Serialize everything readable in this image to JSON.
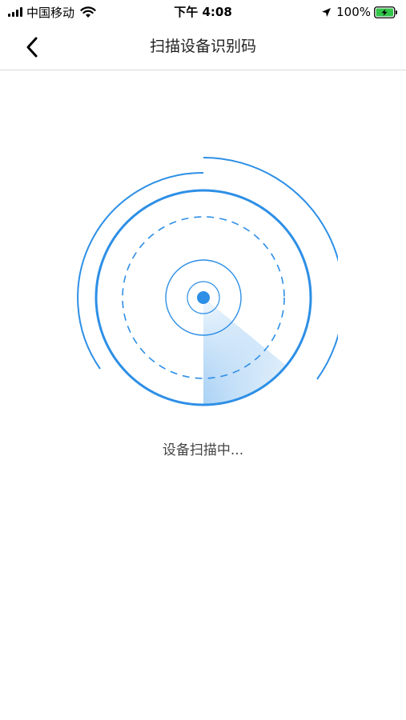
{
  "status_bar": {
    "carrier": "中国移动",
    "time": "下午 4:08",
    "battery_percent": "100%",
    "icons": [
      "signal-icon",
      "wifi-icon",
      "location-arrow-icon",
      "battery-charging-icon"
    ]
  },
  "nav": {
    "title": "扫描设备识别码",
    "back_icon": "chevron-left-icon"
  },
  "scanner": {
    "status_text": "设备扫描中..."
  },
  "colors": {
    "accent": "#2d8fe6",
    "battery_fill": "#33c44a",
    "divider": "#d8d8d8"
  }
}
